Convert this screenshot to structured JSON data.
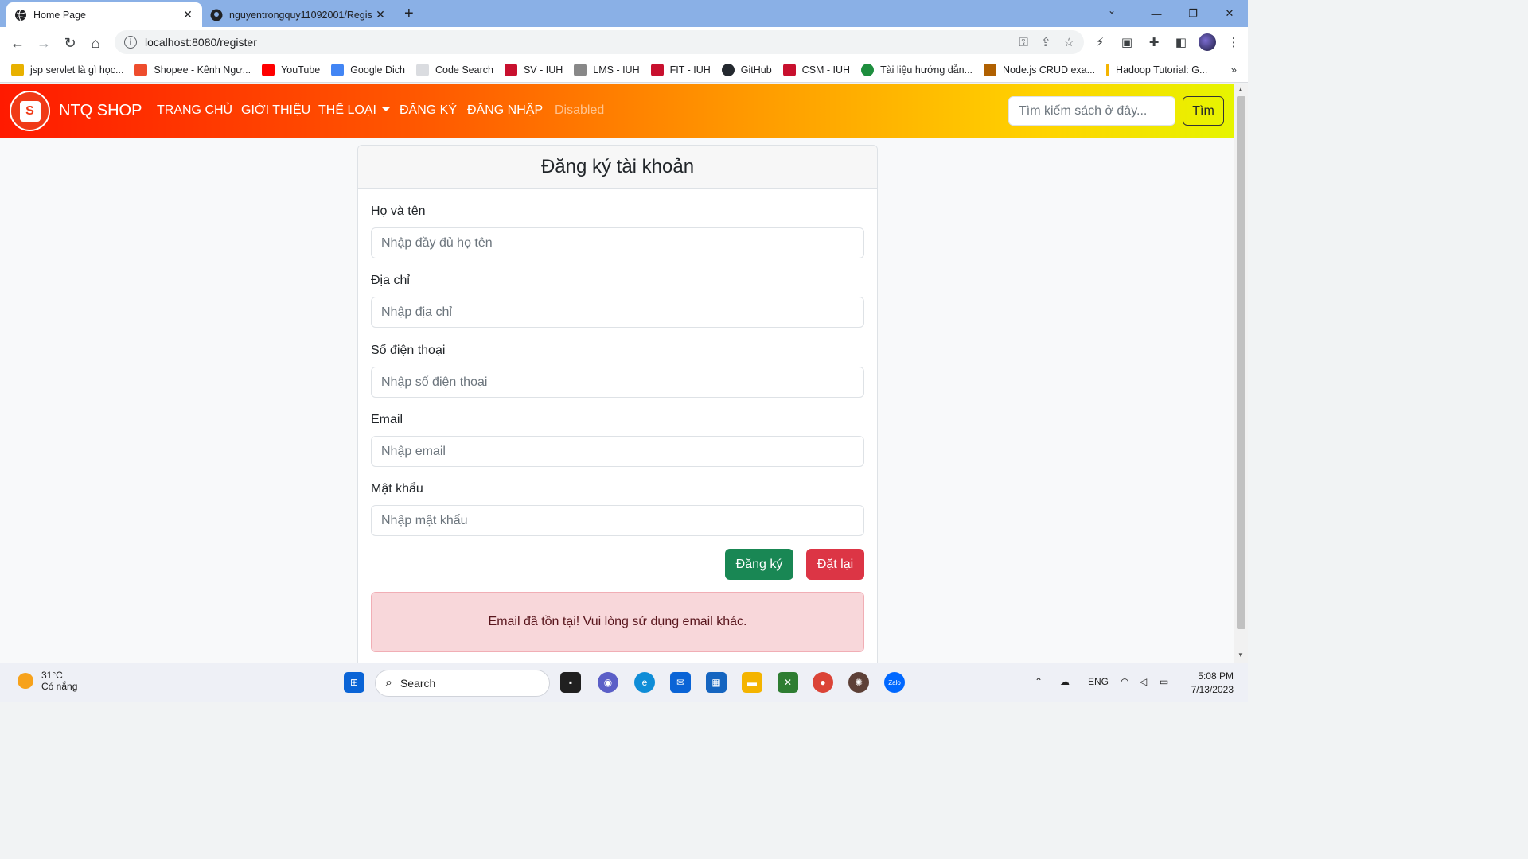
{
  "browser": {
    "tabs": [
      {
        "title": "Home Page",
        "active": true
      },
      {
        "title": "nguyentrongquy11092001/Regis",
        "active": false
      }
    ],
    "url": "localhost:8080/register",
    "bookmarks": [
      {
        "label": "jsp servlet là gì học...",
        "color": "#e8b100"
      },
      {
        "label": "Shopee - Kênh Ngư...",
        "color": "#ee4d2d"
      },
      {
        "label": "YouTube",
        "color": "#ff0000"
      },
      {
        "label": "Google Dich",
        "color": "#4285f4"
      },
      {
        "label": "Code Search",
        "color": "#dadce0"
      },
      {
        "label": "SV - IUH",
        "color": "#c8102e"
      },
      {
        "label": "LMS - IUH",
        "color": "#888888"
      },
      {
        "label": "FIT - IUH",
        "color": "#c8102e"
      },
      {
        "label": "GitHub",
        "color": "#24292f"
      },
      {
        "label": "CSM - IUH",
        "color": "#c8102e"
      },
      {
        "label": "Tài liệu hướng dẫn...",
        "color": "#1e8e3e"
      },
      {
        "label": "Node.js CRUD exa...",
        "color": "#b06000"
      },
      {
        "label": "Hadoop Tutorial: G...",
        "color": "#f4b400"
      }
    ]
  },
  "navbar": {
    "brand": "NTQ SHOP",
    "logo_letter": "S",
    "links": {
      "home": "TRANG CHỦ",
      "about": "GIỚI THIỆU",
      "category": "THỂ LOẠI",
      "register": "ĐĂNG KÝ",
      "login": "ĐĂNG NHẬP",
      "disabled": "Disabled"
    },
    "search_placeholder": "Tìm kiếm sách ở đây...",
    "search_button": "Tìm"
  },
  "form": {
    "title": "Đăng ký tài khoản",
    "fields": {
      "fullname": {
        "label": "Họ và tên",
        "placeholder": "Nhập đầy đủ họ tên"
      },
      "address": {
        "label": "Địa chỉ",
        "placeholder": "Nhập địa chỉ"
      },
      "phone": {
        "label": "Số điện thoại",
        "placeholder": "Nhập số điện thoại"
      },
      "email": {
        "label": "Email",
        "placeholder": "Nhập email"
      },
      "password": {
        "label": "Mật khẩu",
        "placeholder": "Nhập mật khẩu"
      }
    },
    "submit_label": "Đăng ký",
    "reset_label": "Đặt lại",
    "alert": "Email đã tồn tại! Vui lòng sử dụng email khác."
  },
  "taskbar": {
    "temperature": "31°C",
    "weather": "Có nắng",
    "search": "Search",
    "language": "ENG",
    "time": "5:08 PM",
    "date": "7/13/2023"
  },
  "colors": {
    "nav_gradient_start": "#ff1a00",
    "nav_gradient_end": "#e6f500",
    "success": "#198754",
    "danger": "#dc3545",
    "alert_bg": "#f8d7da"
  }
}
